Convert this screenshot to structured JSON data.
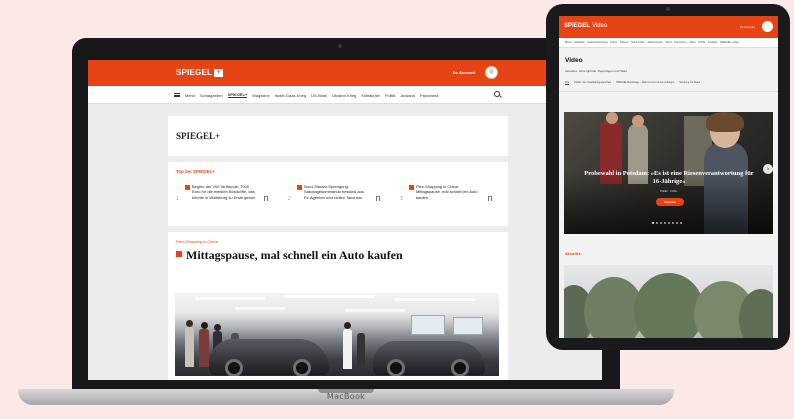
{
  "laptop": {
    "brand": "MacBook",
    "header": {
      "logo": "SPIEGEL",
      "logo_mark": "+",
      "account_label": "Ihr Account"
    },
    "nav": {
      "menu_label": "Menü",
      "items": [
        "Schlagzeilen",
        "SPIEGEL+",
        "Magazine",
        "Israel-Gaza-Krieg",
        "US-Wahl",
        "Ukraine-Krieg",
        "Klimakrise",
        "Politik",
        "Ausland",
        "Panorama"
      ],
      "active_index": 1
    },
    "plus_card": {
      "title": "SPIEGEL+"
    },
    "top_card": {
      "label": "Top bei SPIEGEL+",
      "items": [
        {
          "number": "1",
          "text": "Beginn der VW-Tarifrunde: 7000 Euro für die meisten Büroköfte, das könnte in Wolfsburg zu Ende gehen"
        },
        {
          "number": "2",
          "text": "Nord-Stream-Sprengung: Sabotagekommando bestand aus Ex-Agenten und zivilen Tauchern"
        },
        {
          "number": "3",
          "text": "Plex-Shopping in China: Mittagspause, mal schnell ein Auto kaufen"
        }
      ]
    },
    "article": {
      "kicker": "Plex-Shopping in China",
      "headline": "Mittagspause, mal schnell ein Auto kaufen"
    }
  },
  "tablet": {
    "header": {
      "logo": "SPIEGEL",
      "logo_sub": "Video",
      "account_label": "Ihr Account"
    },
    "topnav": "Menü  Aktuelles  Israel-Gaza-Krieg  Kultur  Wissen  Nachrichten  Rezensionen  Sport  Panorama  Video  Politik  Ausland  SPIEGEL-Leben",
    "title": "Video",
    "subtitle": "Aktuelles, Hintergründe, Reportagen und Talks",
    "subnav": [
      "Alle",
      "Politik: Von Spielplatzgesprächen",
      "SPIEGEL Backstage – Mehr Luxus mit den Kollegen",
      "Sendung mit Maus"
    ],
    "subnav_active": 0,
    "video": {
      "caption": "Probewahl in Potsdam: »Es ist eine Riesenverantwortung für 16-Jährige«",
      "meta": "Politik · 3 Min",
      "play_label": "Abspielen"
    },
    "section_label": "Aktuelles"
  },
  "colors": {
    "brand": "#e64415",
    "background": "#fbe9e7"
  }
}
